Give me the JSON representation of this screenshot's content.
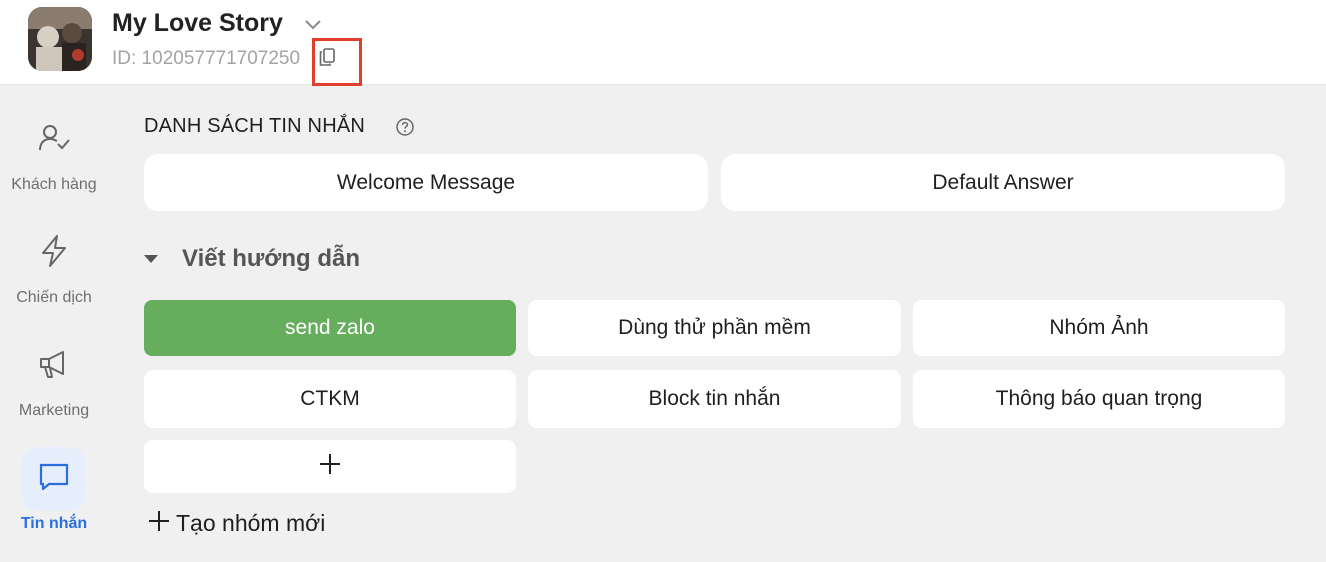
{
  "header": {
    "title": "My Love Story",
    "id_text": "ID: 102057771707250"
  },
  "sidebar": {
    "items": [
      {
        "label": "Khách hàng",
        "icon": "user-check-icon"
      },
      {
        "label": "Chiến dịch",
        "icon": "lightning-icon"
      },
      {
        "label": "Marketing",
        "icon": "megaphone-icon"
      },
      {
        "label": "Tin nhắn",
        "icon": "message-icon",
        "active": true
      }
    ]
  },
  "main": {
    "section_title": "DANH SÁCH TIN NHẮN",
    "top_buttons": [
      "Welcome Message",
      "Default Answer"
    ],
    "group": {
      "title": "Viết hướng dẫn",
      "items": [
        {
          "label": "send zalo",
          "selected": true
        },
        {
          "label": "Dùng thử phần mềm"
        },
        {
          "label": "Nhóm Ảnh"
        },
        {
          "label": "CTKM"
        },
        {
          "label": "Block tin nhắn"
        },
        {
          "label": "Thông báo quan trọng"
        }
      ]
    },
    "create_group_label": "Tạo nhóm mới"
  },
  "colors": {
    "accent_green": "#66ad5e",
    "active_blue": "#2a6fe0",
    "highlight_red": "#e0402a"
  }
}
